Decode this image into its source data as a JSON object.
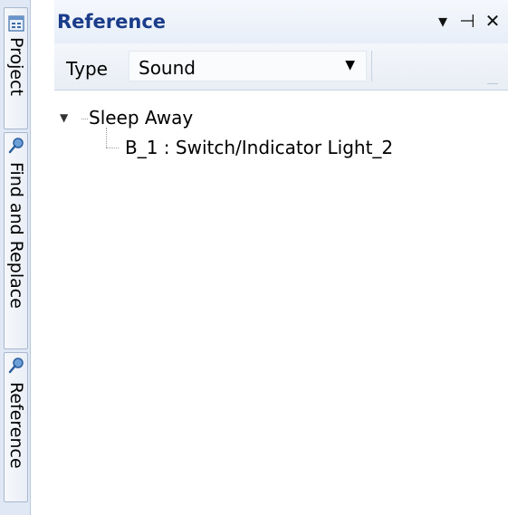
{
  "sidebar": {
    "tabs": [
      {
        "label": "Project",
        "icon": "project-icon"
      },
      {
        "label": "Find and Replace",
        "icon": "search-icon"
      },
      {
        "label": "Reference",
        "icon": "search-icon"
      }
    ]
  },
  "panel": {
    "title": "Reference",
    "buttons": {
      "dropdown": "▾",
      "pin": "⊣",
      "close": "✕"
    }
  },
  "toolbar": {
    "type_label": "Type",
    "type_value": "Sound"
  },
  "tree": {
    "root": "Sleep Away",
    "children": [
      "B_1 : Switch/Indicator Light_2"
    ]
  },
  "colors": {
    "title": "#1a3c8a",
    "tabstrip": "#dfe8f4",
    "header_bg": "#e7eef8"
  }
}
